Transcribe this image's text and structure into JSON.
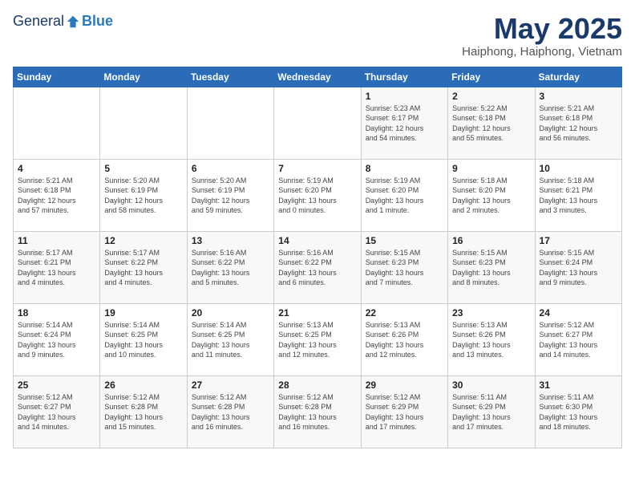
{
  "header": {
    "logo_general": "General",
    "logo_blue": "Blue",
    "title": "May 2025",
    "location": "Haiphong, Haiphong, Vietnam"
  },
  "weekdays": [
    "Sunday",
    "Monday",
    "Tuesday",
    "Wednesday",
    "Thursday",
    "Friday",
    "Saturday"
  ],
  "weeks": [
    [
      {
        "day": "",
        "content": ""
      },
      {
        "day": "",
        "content": ""
      },
      {
        "day": "",
        "content": ""
      },
      {
        "day": "",
        "content": ""
      },
      {
        "day": "1",
        "content": "Sunrise: 5:23 AM\nSunset: 6:17 PM\nDaylight: 12 hours\nand 54 minutes."
      },
      {
        "day": "2",
        "content": "Sunrise: 5:22 AM\nSunset: 6:18 PM\nDaylight: 12 hours\nand 55 minutes."
      },
      {
        "day": "3",
        "content": "Sunrise: 5:21 AM\nSunset: 6:18 PM\nDaylight: 12 hours\nand 56 minutes."
      }
    ],
    [
      {
        "day": "4",
        "content": "Sunrise: 5:21 AM\nSunset: 6:18 PM\nDaylight: 12 hours\nand 57 minutes."
      },
      {
        "day": "5",
        "content": "Sunrise: 5:20 AM\nSunset: 6:19 PM\nDaylight: 12 hours\nand 58 minutes."
      },
      {
        "day": "6",
        "content": "Sunrise: 5:20 AM\nSunset: 6:19 PM\nDaylight: 12 hours\nand 59 minutes."
      },
      {
        "day": "7",
        "content": "Sunrise: 5:19 AM\nSunset: 6:20 PM\nDaylight: 13 hours\nand 0 minutes."
      },
      {
        "day": "8",
        "content": "Sunrise: 5:19 AM\nSunset: 6:20 PM\nDaylight: 13 hours\nand 1 minute."
      },
      {
        "day": "9",
        "content": "Sunrise: 5:18 AM\nSunset: 6:20 PM\nDaylight: 13 hours\nand 2 minutes."
      },
      {
        "day": "10",
        "content": "Sunrise: 5:18 AM\nSunset: 6:21 PM\nDaylight: 13 hours\nand 3 minutes."
      }
    ],
    [
      {
        "day": "11",
        "content": "Sunrise: 5:17 AM\nSunset: 6:21 PM\nDaylight: 13 hours\nand 4 minutes."
      },
      {
        "day": "12",
        "content": "Sunrise: 5:17 AM\nSunset: 6:22 PM\nDaylight: 13 hours\nand 4 minutes."
      },
      {
        "day": "13",
        "content": "Sunrise: 5:16 AM\nSunset: 6:22 PM\nDaylight: 13 hours\nand 5 minutes."
      },
      {
        "day": "14",
        "content": "Sunrise: 5:16 AM\nSunset: 6:22 PM\nDaylight: 13 hours\nand 6 minutes."
      },
      {
        "day": "15",
        "content": "Sunrise: 5:15 AM\nSunset: 6:23 PM\nDaylight: 13 hours\nand 7 minutes."
      },
      {
        "day": "16",
        "content": "Sunrise: 5:15 AM\nSunset: 6:23 PM\nDaylight: 13 hours\nand 8 minutes."
      },
      {
        "day": "17",
        "content": "Sunrise: 5:15 AM\nSunset: 6:24 PM\nDaylight: 13 hours\nand 9 minutes."
      }
    ],
    [
      {
        "day": "18",
        "content": "Sunrise: 5:14 AM\nSunset: 6:24 PM\nDaylight: 13 hours\nand 9 minutes."
      },
      {
        "day": "19",
        "content": "Sunrise: 5:14 AM\nSunset: 6:25 PM\nDaylight: 13 hours\nand 10 minutes."
      },
      {
        "day": "20",
        "content": "Sunrise: 5:14 AM\nSunset: 6:25 PM\nDaylight: 13 hours\nand 11 minutes."
      },
      {
        "day": "21",
        "content": "Sunrise: 5:13 AM\nSunset: 6:25 PM\nDaylight: 13 hours\nand 12 minutes."
      },
      {
        "day": "22",
        "content": "Sunrise: 5:13 AM\nSunset: 6:26 PM\nDaylight: 13 hours\nand 12 minutes."
      },
      {
        "day": "23",
        "content": "Sunrise: 5:13 AM\nSunset: 6:26 PM\nDaylight: 13 hours\nand 13 minutes."
      },
      {
        "day": "24",
        "content": "Sunrise: 5:12 AM\nSunset: 6:27 PM\nDaylight: 13 hours\nand 14 minutes."
      }
    ],
    [
      {
        "day": "25",
        "content": "Sunrise: 5:12 AM\nSunset: 6:27 PM\nDaylight: 13 hours\nand 14 minutes."
      },
      {
        "day": "26",
        "content": "Sunrise: 5:12 AM\nSunset: 6:28 PM\nDaylight: 13 hours\nand 15 minutes."
      },
      {
        "day": "27",
        "content": "Sunrise: 5:12 AM\nSunset: 6:28 PM\nDaylight: 13 hours\nand 16 minutes."
      },
      {
        "day": "28",
        "content": "Sunrise: 5:12 AM\nSunset: 6:28 PM\nDaylight: 13 hours\nand 16 minutes."
      },
      {
        "day": "29",
        "content": "Sunrise: 5:12 AM\nSunset: 6:29 PM\nDaylight: 13 hours\nand 17 minutes."
      },
      {
        "day": "30",
        "content": "Sunrise: 5:11 AM\nSunset: 6:29 PM\nDaylight: 13 hours\nand 17 minutes."
      },
      {
        "day": "31",
        "content": "Sunrise: 5:11 AM\nSunset: 6:30 PM\nDaylight: 13 hours\nand 18 minutes."
      }
    ]
  ]
}
